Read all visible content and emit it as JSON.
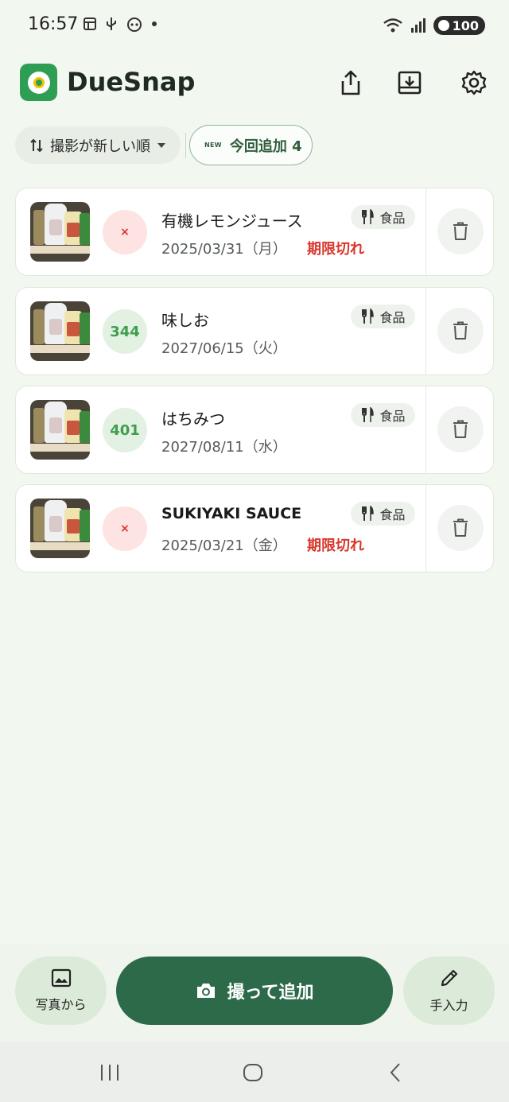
{
  "status_bar": {
    "time": "16:57",
    "battery": "100"
  },
  "app": {
    "title": "DueSnap"
  },
  "sort": {
    "label": "撮影が新しい順"
  },
  "new_filter": {
    "badge": "NEW",
    "label": "今回追加 4"
  },
  "items": [
    {
      "name": "有機レモンジュース",
      "date": "2025/03/31（月）",
      "status": "期限切れ",
      "days": "×",
      "expired": true,
      "category": "食品"
    },
    {
      "name": "味しお",
      "date": "2027/06/15（火）",
      "status": "",
      "days": "344",
      "expired": false,
      "category": "食品"
    },
    {
      "name": "はちみつ",
      "date": "2027/08/11（水）",
      "status": "",
      "days": "401",
      "expired": false,
      "category": "食品"
    },
    {
      "name": "SUKIYAKI SAUCE",
      "date": "2025/03/21（金）",
      "status": "期限切れ",
      "days": "×",
      "expired": true,
      "category": "食品"
    }
  ],
  "actions": {
    "from_photo": "写真から",
    "capture_add": "撮って追加",
    "manual": "手入力"
  },
  "icons": [
    "share-icon",
    "import-icon",
    "settings-icon",
    "sort-icon",
    "dropdown-icon",
    "fork-knife-icon",
    "trash-icon",
    "image-icon",
    "camera-icon",
    "pencil-icon"
  ],
  "colors": {
    "brand": "#2d6a4a",
    "expired": "#d9362c",
    "ok": "#3f9e4b",
    "background": "#f2f8ef"
  }
}
